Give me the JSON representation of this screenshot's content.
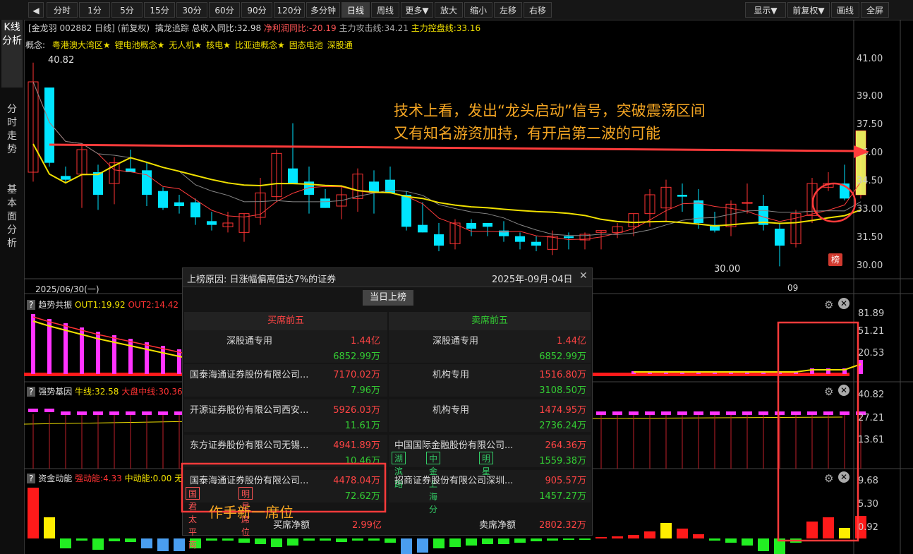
{
  "toolbar": {
    "items": [
      "分时",
      "1分",
      "5分",
      "15分",
      "30分",
      "60分",
      "90分",
      "120分",
      "多分钟",
      "日线",
      "周线",
      "更多▼",
      "放大",
      "缩小",
      "左移",
      "右移"
    ],
    "right_items": [
      "显示▼",
      "前复权▼",
      "画线",
      "全屏"
    ],
    "active": "日线"
  },
  "sidebar": {
    "tabs": [
      "K线分析",
      "分时走势",
      "基本面分析"
    ]
  },
  "stock": {
    "name_code": "[金龙羽 002882 日线]",
    "adj": "(前复权)",
    "indicator_name": "擒龙追踪",
    "rev_growth": "总收入同比:32.98",
    "profit_growth": "净利润同比:-20.19",
    "attack_line": "主力攻击线:34.21",
    "control_line": "主力控盘线:33.16"
  },
  "concepts": {
    "label": "概念:",
    "items": [
      "粤港澳大湾区★",
      "锂电池概念★",
      "无人机★",
      "核电★",
      "比亚迪概念★",
      "固态电池",
      "深股通"
    ]
  },
  "price_axis": [
    "41.00",
    "39.00",
    "37.50",
    "36.00",
    "34.50",
    "33.00",
    "31.50",
    "30.00"
  ],
  "markers": {
    "high": "40.82",
    "low": "30.00",
    "bang": "榜",
    "start_date": "2025/06/30(一)",
    "month": "09"
  },
  "annotation": {
    "line1": "技术上看，发出“龙头启动”信号，突破震荡区间",
    "line2": "又有知名游资加持，有开启第二波的可能",
    "bottom": "作手新一席位"
  },
  "panels": {
    "trend": {
      "name": "趋势共振",
      "out1": "OUT1:19.92",
      "out2": "OUT2:14.42",
      "axis": [
        "81.89",
        "51.21",
        "20.53"
      ]
    },
    "gene": {
      "name": "强势基因",
      "ma": "牛线:32.58",
      "mid": "大盘中线:30.36",
      "axis": [
        "40.82",
        "27.21",
        "13.61"
      ]
    },
    "fund": {
      "name": "资金动能",
      "strong": "强动能:4.33",
      "mid": "中动能:0.00",
      "extra": "无",
      "axis": [
        "9.68",
        "5.30",
        "0.92"
      ]
    }
  },
  "popup": {
    "reason": "上榜原因: 日涨幅偏离值达7%的证券",
    "date": "2025年-09月-04日",
    "button": "当日上榜",
    "buy_title": "买席前五",
    "sell_title": "卖席前五",
    "buy": [
      {
        "name": "深股通专用",
        "buy": "1.44亿",
        "sell": "6852.99万"
      },
      {
        "name": "国泰海通证券股份有限公司...",
        "buy": "7170.02万",
        "sell": "7.96万"
      },
      {
        "name": "开源证券股份有限公司西安...",
        "buy": "5926.03万",
        "sell": "11.61万"
      },
      {
        "name": "东方证券股份有限公司无锡...",
        "buy": "4941.89万",
        "sell": "10.46万"
      },
      {
        "name": "国泰海通证券股份有限公司...",
        "buy": "4478.04万",
        "sell": "72.62万",
        "tags": [
          "国君太平南",
          "明星席位"
        ]
      }
    ],
    "sell": [
      {
        "name": "深股通专用",
        "buy": "1.44亿",
        "sell": "6852.99万"
      },
      {
        "name": "机构专用",
        "buy": "1516.80万",
        "sell": "3108.50万"
      },
      {
        "name": "机构专用",
        "buy": "1474.95万",
        "sell": "2736.24万"
      },
      {
        "name": "中国国际金融股份有限公司...",
        "buy": "264.36万",
        "sell": "1559.38万",
        "tags": [
          "湖滨路",
          "中金上海分",
          "明星"
        ]
      },
      {
        "name": "招商证券股份有限公司深圳...",
        "buy": "905.57万",
        "sell": "1457.27万"
      }
    ],
    "buy_net_label": "买席净额",
    "buy_net": "2.99亿",
    "sell_net_label": "卖席净额",
    "sell_net": "2802.32万"
  },
  "chart_data": {
    "type": "candlestick",
    "ylim": [
      29.6,
      41.6
    ],
    "candles": [
      [
        35.0,
        40.82,
        34.5,
        39.8
      ],
      [
        39.5,
        39.5,
        35.3,
        35.5
      ],
      [
        34.8,
        35.3,
        34.4,
        34.6
      ],
      [
        34.9,
        36.4,
        33.1,
        36.2
      ],
      [
        35.0,
        35.4,
        33.0,
        33.8
      ],
      [
        34.4,
        35.8,
        33.3,
        35.5
      ],
      [
        35.2,
        36.2,
        35.2,
        35.0
      ],
      [
        35.1,
        35.5,
        33.2,
        33.8
      ],
      [
        34.0,
        34.2,
        33.0,
        33.1
      ],
      [
        33.4,
        33.8,
        32.8,
        33.2
      ],
      [
        33.4,
        33.6,
        32.2,
        32.6
      ],
      [
        32.4,
        32.9,
        31.9,
        32.2
      ],
      [
        32.1,
        32.9,
        31.8,
        32.3
      ],
      [
        31.8,
        32.8,
        31.3,
        32.8
      ],
      [
        32.6,
        34.7,
        32.2,
        33.9
      ],
      [
        33.7,
        36.2,
        33.5,
        36.0
      ],
      [
        35.2,
        37.6,
        34.5,
        34.4
      ],
      [
        34.5,
        35.3,
        32.8,
        33.8
      ],
      [
        33.6,
        34.1,
        33.1,
        33.1
      ],
      [
        33.2,
        34.2,
        32.5,
        33.8
      ],
      [
        33.6,
        35.2,
        32.9,
        34.9
      ],
      [
        34.5,
        35.1,
        32.8,
        33.9
      ],
      [
        34.6,
        35.3,
        33.9,
        33.9
      ],
      [
        33.8,
        34.0,
        31.9,
        32.1
      ],
      [
        32.2,
        33.4,
        31.8,
        31.8
      ],
      [
        31.7,
        32.3,
        30.8,
        31.1
      ],
      [
        31.2,
        32.5,
        30.9,
        32.3
      ],
      [
        32.3,
        32.5,
        31.6,
        32.0
      ],
      [
        32.3,
        32.3,
        31.6,
        32.1
      ],
      [
        31.9,
        32.4,
        31.3,
        31.6
      ],
      [
        31.6,
        31.8,
        30.9,
        31.3
      ],
      [
        31.3,
        31.6,
        30.8,
        31.1
      ],
      [
        30.9,
        31.9,
        30.6,
        31.6
      ],
      [
        31.6,
        31.8,
        30.9,
        31.5
      ],
      [
        31.4,
        31.8,
        30.9,
        31.7
      ],
      [
        31.8,
        31.9,
        30.9,
        31.9
      ],
      [
        31.8,
        32.3,
        31.5,
        32.1
      ],
      [
        32.1,
        32.8,
        31.6,
        32.8
      ],
      [
        32.8,
        34.1,
        32.1,
        33.8
      ],
      [
        33.1,
        34.6,
        32.4,
        34.2
      ],
      [
        33.8,
        34.4,
        32.9,
        33.7
      ],
      [
        33.5,
        34.1,
        32.0,
        32.3
      ],
      [
        32.2,
        32.9,
        31.8,
        31.9
      ],
      [
        32.1,
        33.5,
        31.6,
        33.3
      ],
      [
        33.4,
        34.4,
        32.8,
        33.4
      ],
      [
        33.2,
        33.8,
        31.9,
        32.2
      ],
      [
        32.0,
        32.3,
        30.0,
        31.1
      ],
      [
        31.2,
        33.0,
        31.0,
        32.8
      ],
      [
        32.7,
        34.7,
        32.3,
        34.4
      ],
      [
        34.2,
        35.0,
        34.0,
        34.4
      ],
      [
        34.4,
        35.4,
        33.5,
        33.6
      ],
      [
        33.8,
        36.0,
        33.6,
        37.2
      ]
    ]
  }
}
